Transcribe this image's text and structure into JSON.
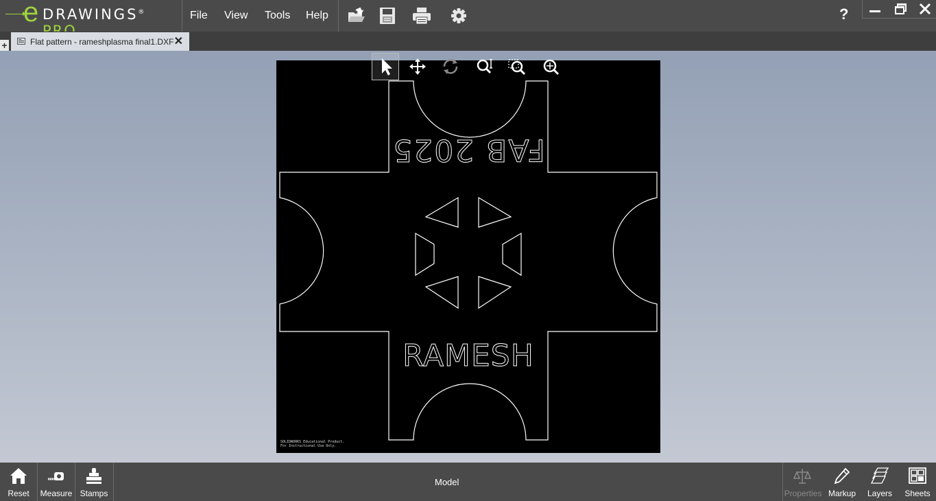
{
  "app": {
    "logo_e": "e",
    "logo_text": "DRAWINGS",
    "logo_reg": "®",
    "logo_pro": "PRO",
    "menu": [
      "File",
      "View",
      "Tools",
      "Help"
    ],
    "toolbar_icons": [
      "open-icon",
      "save-icon",
      "print-icon",
      "settings-icon"
    ],
    "help_label": "?",
    "window_controls": [
      "minimize-icon",
      "restore-icon",
      "close-icon"
    ]
  },
  "tabs": {
    "new_tab_label": "+",
    "document": {
      "label": "Flat pattern - rameshplasma final1.DXF",
      "close_label": "✕"
    }
  },
  "viewer": {
    "tools": [
      "select-icon",
      "pan-icon",
      "rotate-icon",
      "zoom-icon",
      "zoom-area-icon",
      "zoom-fit-icon"
    ],
    "selected_tool": "select-icon",
    "drawing_text_top": "FAB 2025",
    "drawing_text_bottom": "RAMESH",
    "watermark_line1": "SOLIDWORKS Educational Product.",
    "watermark_line2": "For Instructional Use Only.",
    "background_color": "#000000",
    "line_color": "#ffffff"
  },
  "bottom": {
    "left_buttons": [
      {
        "label": "Reset",
        "icon": "home-icon"
      },
      {
        "label": "Measure",
        "icon": "tape-measure-icon"
      },
      {
        "label": "Stamps",
        "icon": "stamp-icon"
      }
    ],
    "center_label": "Model",
    "right_buttons": [
      {
        "label": "Properties",
        "icon": "scale-icon",
        "enabled": false
      },
      {
        "label": "Markup",
        "icon": "pencil-icon",
        "enabled": true
      },
      {
        "label": "Layers",
        "icon": "layers-icon",
        "enabled": true
      },
      {
        "label": "Sheets",
        "icon": "sheets-icon",
        "enabled": true
      }
    ]
  },
  "colors": {
    "accent": "#9fd33f",
    "titlebar": "#4a4a4a",
    "tabbar": "#3e3e3e",
    "tab_active": "#d9dde3"
  }
}
